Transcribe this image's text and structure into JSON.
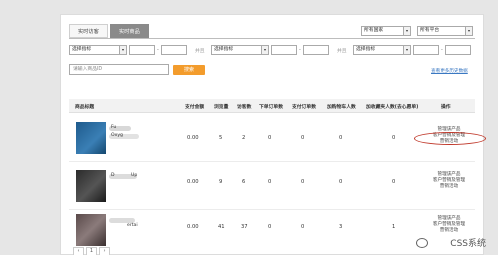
{
  "tabs": [
    "实时访客",
    "实时商品"
  ],
  "filters": {
    "country": "所有国家",
    "platform": "所有平台",
    "metric1": "选择指标",
    "metric2": "选择指标",
    "metric3": "选择指标",
    "joiner": "并且",
    "search_placeholder": "请输入商品ID",
    "search_button": "搜索",
    "history_link": "查看更多历史数据"
  },
  "table": {
    "headers": [
      "商品标题",
      "支付金额",
      "浏览量",
      "访客数",
      "下单订单数",
      "支付订单数",
      "加购物车人数",
      "加收藏夹人数(去心愿单)",
      "操作"
    ],
    "rows": [
      {
        "title_fragments": [
          "Fu",
          "Oxyg"
        ],
        "amount": "0.00",
        "pv": "5",
        "uv": "2",
        "orders": "0",
        "paid_orders": "0",
        "cart_users": "0",
        "fav_users": "0"
      },
      {
        "title_fragments": [
          "D",
          "Up"
        ],
        "amount": "0.00",
        "pv": "9",
        "uv": "6",
        "orders": "0",
        "paid_orders": "0",
        "cart_users": "0",
        "fav_users": "0"
      },
      {
        "title_fragments": [
          "ertai"
        ],
        "amount": "0.00",
        "pv": "41",
        "uv": "37",
        "orders": "0",
        "paid_orders": "0",
        "cart_users": "3",
        "fav_users": "1"
      }
    ],
    "ops": [
      "管理该产品",
      "客户营销及管理",
      "营销活动"
    ]
  },
  "pager": [
    "‹",
    "1",
    "›"
  ],
  "watermark": "CSS系统",
  "colors": {
    "tab_active": "#8a8a8a",
    "search_button": "#f39c2c",
    "link": "#3a78c2",
    "annotation": "#c0392b"
  }
}
